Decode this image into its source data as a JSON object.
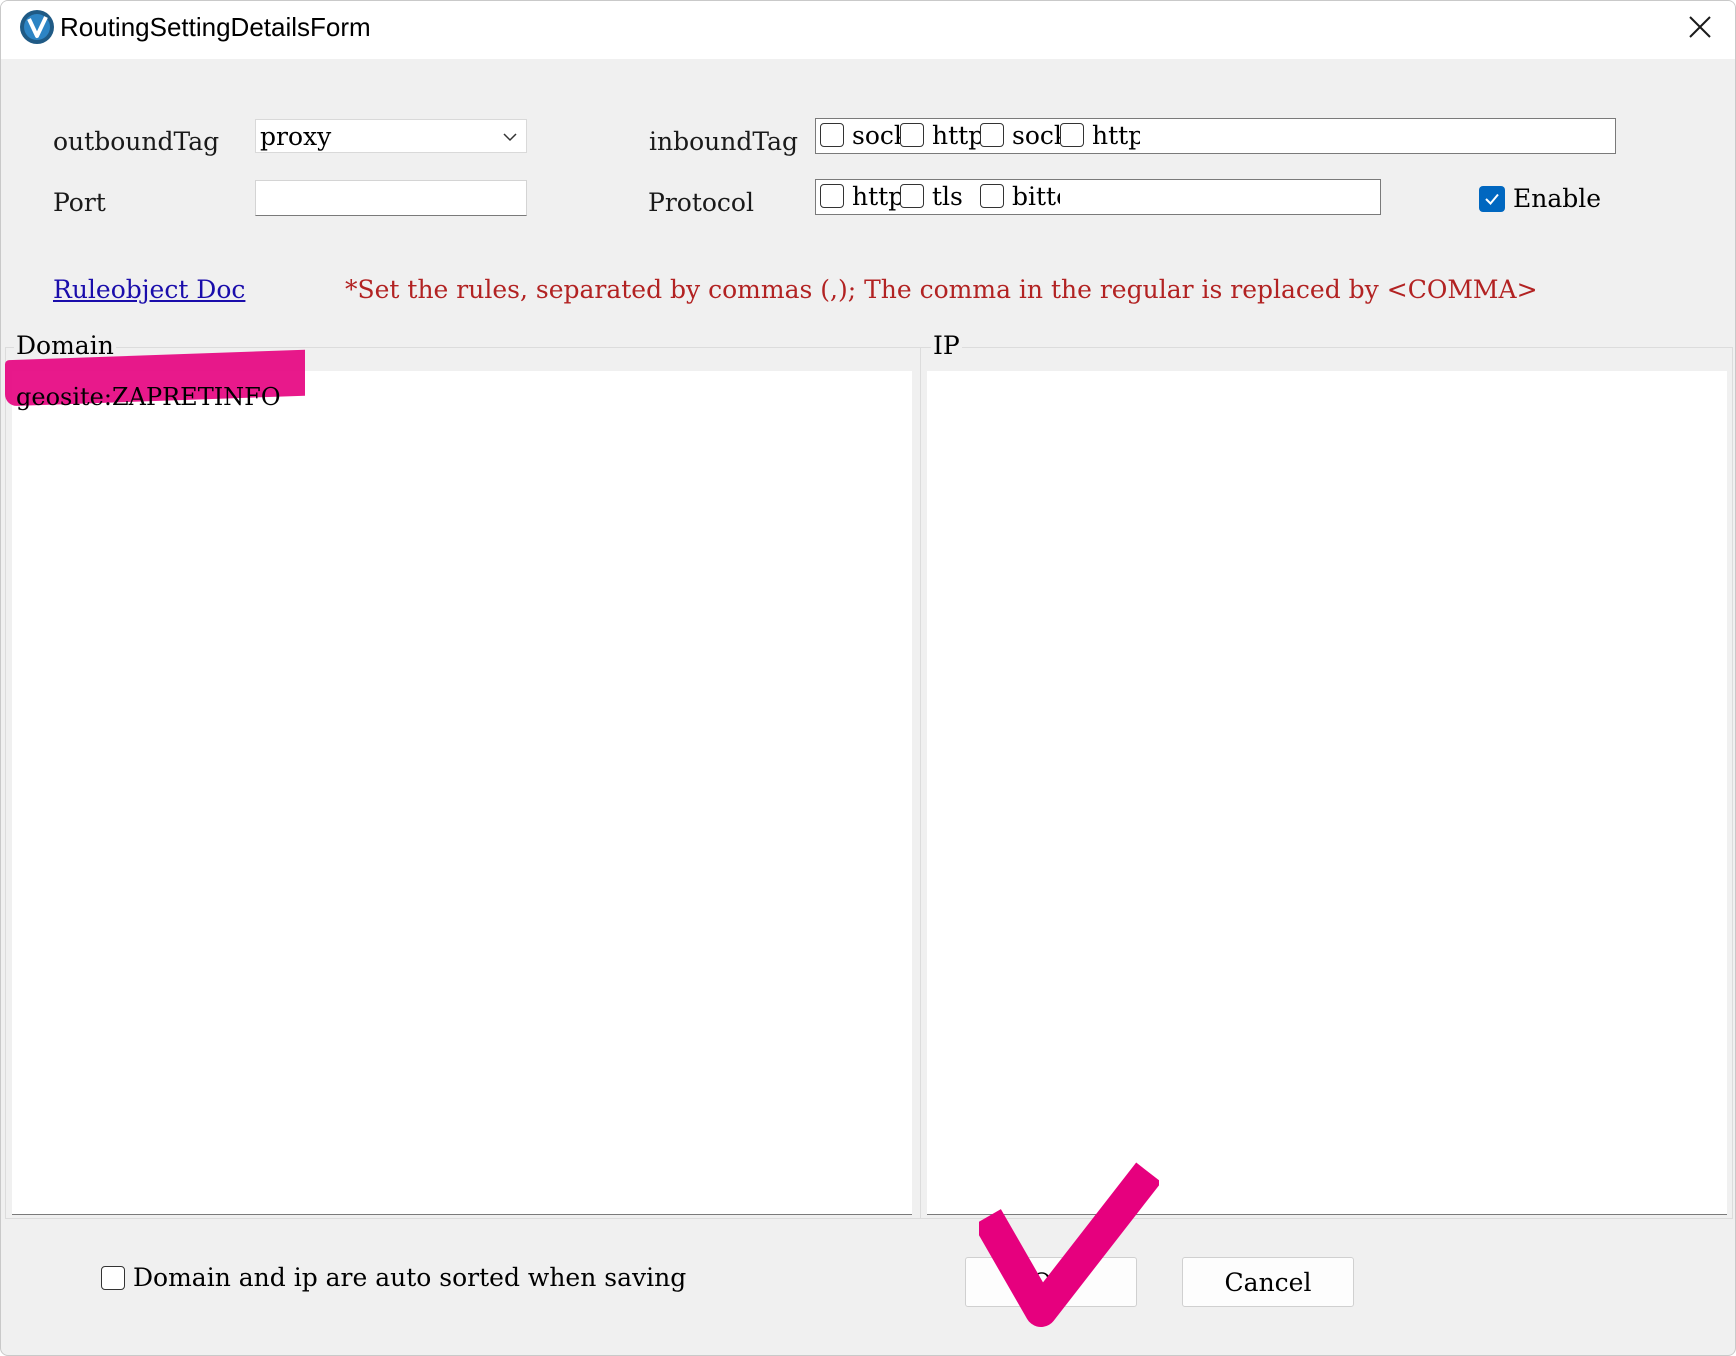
{
  "window": {
    "title": "RoutingSettingDetailsForm"
  },
  "form": {
    "outbound_label": "outboundTag",
    "outbound_value": "proxy",
    "inbound_label": "inboundTag",
    "inbound_items": [
      "socks",
      "http",
      "socks",
      "http"
    ],
    "port_label": "Port",
    "port_value": "",
    "protocol_label": "Protocol",
    "protocol_items": [
      "http",
      "tls",
      "bittorrent"
    ],
    "enable_label": "Enable",
    "enable_checked": true,
    "doc_link": "Ruleobject Doc",
    "hint": "*Set the rules, separated by commas (,); The comma in the regular is replaced by <COMMA>"
  },
  "domain": {
    "label": "Domain",
    "value": "geosite:ZAPRETINFO"
  },
  "ip": {
    "label": "IP",
    "value": ""
  },
  "footer": {
    "auto_sort_label": "Domain and ip are auto sorted when saving",
    "ok_label": "OK",
    "cancel_label": "Cancel"
  },
  "colors": {
    "accent": "#0067c0",
    "link": "#1a0dab",
    "hint": "#b22222",
    "annotation": "#e6007e"
  },
  "icons": {
    "app": "v2rayn-logo-icon",
    "close": "close-icon",
    "dropdown": "chevron-down-icon",
    "check": "checkmark-icon"
  }
}
